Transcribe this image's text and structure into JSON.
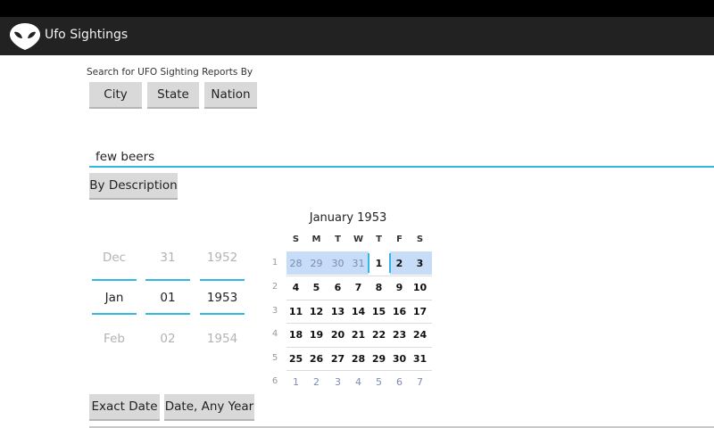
{
  "app": {
    "title": "Ufo Sightings",
    "icon": "alien-head-icon",
    "action_bar_color": "#222222"
  },
  "search": {
    "label": "Search for UFO Sighting Reports By",
    "buttons": {
      "city": "City",
      "state": "State",
      "nation": "Nation"
    }
  },
  "description": {
    "value": "few beers",
    "button": "By Description",
    "accent": "#33b5e5"
  },
  "date_picker": {
    "month": {
      "prev": "Dec",
      "current": "Jan",
      "next": "Feb"
    },
    "day": {
      "prev": "31",
      "current": "01",
      "next": "02"
    },
    "year": {
      "prev": "1952",
      "current": "1953",
      "next": "1954"
    }
  },
  "calendar": {
    "title": "January 1953",
    "weekdays": [
      "S",
      "M",
      "T",
      "W",
      "T",
      "F",
      "S"
    ],
    "weeks": [
      {
        "num": "1",
        "days": [
          "28",
          "29",
          "30",
          "31",
          "1",
          "2",
          "3"
        ]
      },
      {
        "num": "2",
        "days": [
          "4",
          "5",
          "6",
          "7",
          "8",
          "9",
          "10"
        ]
      },
      {
        "num": "3",
        "days": [
          "11",
          "12",
          "13",
          "14",
          "15",
          "16",
          "17"
        ]
      },
      {
        "num": "4",
        "days": [
          "18",
          "19",
          "20",
          "21",
          "22",
          "23",
          "24"
        ]
      },
      {
        "num": "5",
        "days": [
          "25",
          "26",
          "27",
          "28",
          "29",
          "30",
          "31"
        ]
      },
      {
        "num": "6",
        "days": [
          "1",
          "2",
          "3",
          "4",
          "5",
          "6",
          "7"
        ]
      }
    ],
    "selected_week": "1",
    "selected_day": "1",
    "highlight_color": "#c6dcf7"
  },
  "date_buttons": {
    "exact": "Exact Date",
    "any_year": "Date, Any Year"
  }
}
